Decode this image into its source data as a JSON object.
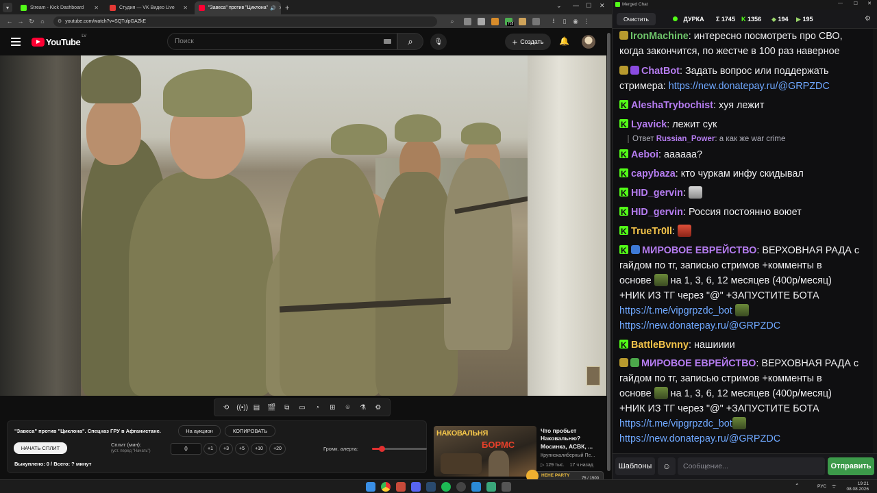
{
  "browser": {
    "tabs": [
      {
        "label": "Stream - Kick Dashboard",
        "favicon_color": "#53fc18",
        "active": false
      },
      {
        "label": "Студия — VK Видео Live",
        "favicon_color": "#e53935",
        "active": false
      },
      {
        "label": "\"Завеса\" против \"Циклона\"",
        "favicon_color": "#ff0033",
        "active": true
      }
    ],
    "new_tab": "+",
    "url": "youtube.com/watch?v=SQTulpGAZkE",
    "ext_badge": "718"
  },
  "youtube": {
    "logo_text": "YouTube",
    "region": "LV",
    "search_placeholder": "Поиск",
    "create_label": "Создать",
    "menu_icon": "hamburger-icon",
    "brand_color": "#ff0033"
  },
  "panel": {
    "video_title": "\"Завеса\" против \"Циклона\". Спецназ ГРУ в Афганистане.",
    "auction_btn": "На аукцион",
    "copy_btn": "КОПИРОВАТЬ",
    "start_split": "НАЧАТЬ СПЛИТ",
    "split_label": "Сплит (мин):",
    "split_hint": "(уст. перед \"Начать\")",
    "minutes_value": "0",
    "steps": [
      "+1",
      "+3",
      "+5",
      "+10",
      "+20"
    ],
    "volume_label": "Громк. алерта:",
    "volume_level": 0.18,
    "bought_text": "Выкуплено: 0 / Всего: ? минут"
  },
  "recommended": {
    "thumb_text_1": "НАКОВАЛЬНЯ",
    "thumb_text_2": "БОРМС",
    "title": "Что пробьет Наковальню? Мосинка, АСВК, ...",
    "channel": "Крупнокалиберный Пе...",
    "views": "129 тыс.",
    "age": "17 ч назад"
  },
  "overlay": {
    "label": "HEHE PARTY",
    "count": "75 / 1500"
  },
  "chat": {
    "window_title": "Merged Chat",
    "clear_btn": "Очистить",
    "status_label": "ДУРКА",
    "status_color": "#53fc18",
    "stats": [
      {
        "icon": "sigma-icon",
        "symbol": "Σ",
        "value": "1745"
      },
      {
        "icon": "kick-icon",
        "symbol": "K",
        "value": "1356"
      },
      {
        "icon": "vk-icon",
        "symbol": "◆",
        "value": "194"
      },
      {
        "icon": "youtube-icon",
        "symbol": "▶",
        "value": "195"
      }
    ],
    "messages": [
      {
        "user": "IronMachine",
        "color": "#6ec46a",
        "badge": "emote",
        "text": "интересно посмотреть про СВО, когда закончится, по жестче  в 100 раз наверное"
      },
      {
        "user": "ChatBot",
        "color": "#b57cf0",
        "badge": "bot",
        "text": "Задать вопрос или поддержать стримера:",
        "link": "https://new.donatepay.ru/@GRPZDC"
      },
      {
        "user": "AleshaTrybochist",
        "color": "#b57cf0",
        "badge": "kick",
        "text": "хуя лежит"
      },
      {
        "user": "Lyavick",
        "color": "#b57cf0",
        "badge": "kick",
        "text": "лежит сук"
      },
      {
        "user": "Aeboi",
        "color": "#b57cf0",
        "badge": "kick",
        "text": "аааааа?"
      },
      {
        "user": "capybaza",
        "color": "#b57cf0",
        "badge": "kick",
        "text": "кто чуркам инфу скидывал"
      },
      {
        "user": "HID_gervin",
        "color": "#b57cf0",
        "badge": "kick",
        "text": ""
      },
      {
        "user": "HID_gervin",
        "color": "#b57cf0",
        "badge": "kick",
        "text": "Россия постоянно воюет"
      },
      {
        "user": "TrueTr0ll",
        "color": "#f3c34a",
        "badge": "kick",
        "text": ""
      },
      {
        "user": "МИРОВОЕ ЕВРЕЙСТВО",
        "color": "#b57cf0",
        "badge": "kick",
        "text_lines": [
          "ВЕРХОВНАЯ РАДА с",
          "гайдом по тг, записью стримов +комменты в",
          "на 1, 3, 6, 12 месяцев (400р/месяц)",
          "+НИК ИЗ ТГ через \"@\" +ЗАПУСТИТЕ БОТА"
        ],
        "base_word": "основе",
        "links": [
          "https://t.me/vipgrpzdc_bot",
          "https://new.donatepay.ru/@GRPZDC"
        ]
      },
      {
        "user": "BattleBvnny",
        "color": "#f3c34a",
        "badge": "kick",
        "text": "нашииии"
      },
      {
        "user": "МИРОВОЕ ЕВРЕЙСТВО",
        "color": "#b57cf0",
        "badge": "emote",
        "text_lines": [
          "ВЕРХОВНАЯ РАДА с",
          "гайдом по тг, записью стримов +комменты в",
          "на 1, 3, 6, 12 месяцев (400р/месяц)",
          "+НИК ИЗ ТГ через \"@\" +ЗАПУСТИТЕ БОТА"
        ],
        "base_word": "основе",
        "links": [
          "https://t.me/vipgrpzdc_bot",
          "https://new.donatepay.ru/@GRPZDC"
        ]
      }
    ],
    "reply": {
      "prefix": "Ответ",
      "user": "Russian_Power",
      "text": ": а как же war crime"
    },
    "templates_btn": "Шаблоны",
    "input_placeholder": "Сообщение...",
    "send_btn": "Отправить",
    "accent": "#53fc18"
  },
  "taskbar": {
    "lang": "РУС",
    "time": "19:21",
    "date": "08.08.2026"
  }
}
